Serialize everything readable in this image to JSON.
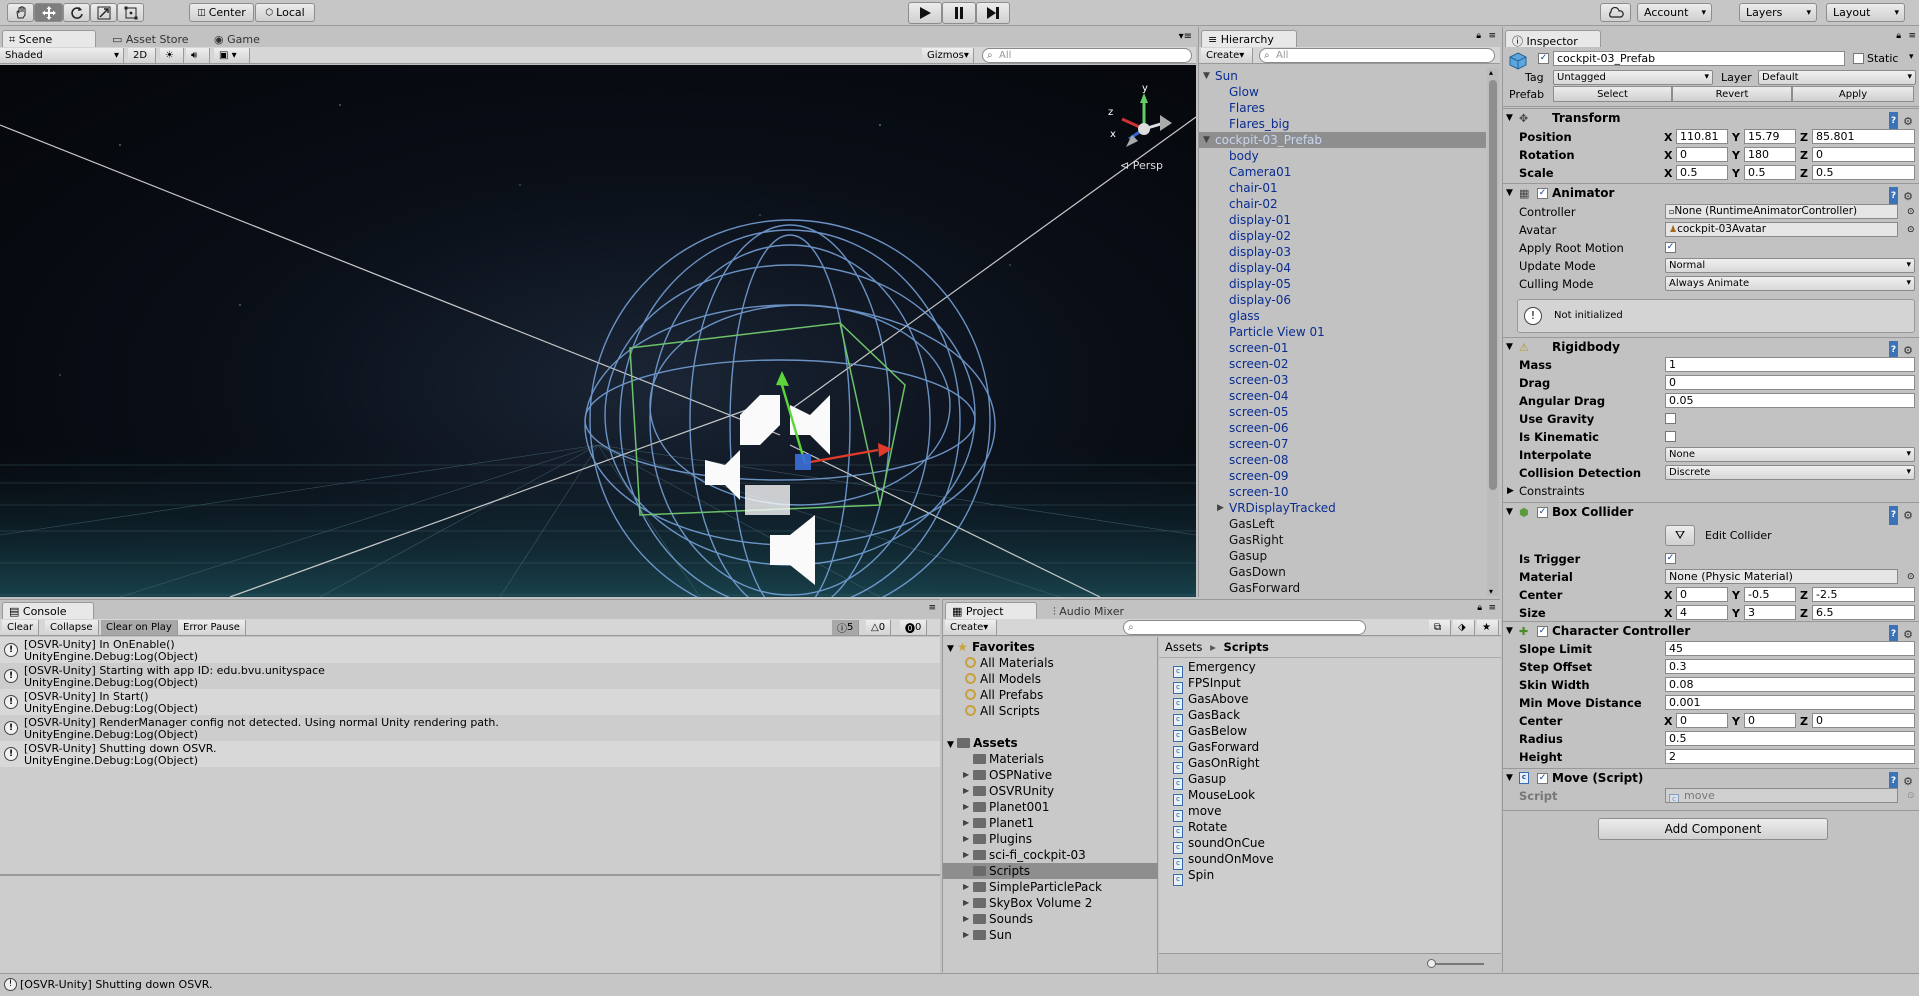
{
  "toolbar": {
    "center_label": "Center",
    "local_label": "Local",
    "account_label": "Account",
    "layers_label": "Layers",
    "layout_label": "Layout"
  },
  "scene": {
    "tabs": [
      "Scene",
      "Asset Store",
      "Game"
    ],
    "shading": "Shaded",
    "mode_2d": "2D",
    "gizmos_label": "Gizmos",
    "search_placeholder": "All",
    "persp_label": "Persp",
    "axis_y": "y",
    "axis_z": "z",
    "axis_x": "x"
  },
  "hierarchy": {
    "tab": "Hierarchy",
    "create_label": "Create",
    "search_placeholder": "All",
    "items": [
      {
        "label": "Sun",
        "depth": 0,
        "arrow": "▼",
        "color": "blue"
      },
      {
        "label": "Glow",
        "depth": 1,
        "arrow": "",
        "color": "blue"
      },
      {
        "label": "Flares",
        "depth": 1,
        "arrow": "",
        "color": "blue"
      },
      {
        "label": "Flares_big",
        "depth": 1,
        "arrow": "",
        "color": "blue"
      },
      {
        "label": "cockpit-03_Prefab",
        "depth": 0,
        "arrow": "▼",
        "color": "blue",
        "selected": true
      },
      {
        "label": "body",
        "depth": 1,
        "arrow": "",
        "color": "blue"
      },
      {
        "label": "Camera01",
        "depth": 1,
        "arrow": "",
        "color": "blue"
      },
      {
        "label": "chair-01",
        "depth": 1,
        "arrow": "",
        "color": "blue"
      },
      {
        "label": "chair-02",
        "depth": 1,
        "arrow": "",
        "color": "blue"
      },
      {
        "label": "display-01",
        "depth": 1,
        "arrow": "",
        "color": "blue"
      },
      {
        "label": "display-02",
        "depth": 1,
        "arrow": "",
        "color": "blue"
      },
      {
        "label": "display-03",
        "depth": 1,
        "arrow": "",
        "color": "blue"
      },
      {
        "label": "display-04",
        "depth": 1,
        "arrow": "",
        "color": "blue"
      },
      {
        "label": "display-05",
        "depth": 1,
        "arrow": "",
        "color": "blue"
      },
      {
        "label": "display-06",
        "depth": 1,
        "arrow": "",
        "color": "blue"
      },
      {
        "label": "glass",
        "depth": 1,
        "arrow": "",
        "color": "blue"
      },
      {
        "label": "Particle View 01",
        "depth": 1,
        "arrow": "",
        "color": "blue"
      },
      {
        "label": "screen-01",
        "depth": 1,
        "arrow": "",
        "color": "blue"
      },
      {
        "label": "screen-02",
        "depth": 1,
        "arrow": "",
        "color": "blue"
      },
      {
        "label": "screen-03",
        "depth": 1,
        "arrow": "",
        "color": "blue"
      },
      {
        "label": "screen-04",
        "depth": 1,
        "arrow": "",
        "color": "blue"
      },
      {
        "label": "screen-05",
        "depth": 1,
        "arrow": "",
        "color": "blue"
      },
      {
        "label": "screen-06",
        "depth": 1,
        "arrow": "",
        "color": "blue"
      },
      {
        "label": "screen-07",
        "depth": 1,
        "arrow": "",
        "color": "blue"
      },
      {
        "label": "screen-08",
        "depth": 1,
        "arrow": "",
        "color": "blue"
      },
      {
        "label": "screen-09",
        "depth": 1,
        "arrow": "",
        "color": "blue"
      },
      {
        "label": "screen-10",
        "depth": 1,
        "arrow": "",
        "color": "blue"
      },
      {
        "label": "VRDisplayTracked",
        "depth": 1,
        "arrow": "▶",
        "color": "blue"
      },
      {
        "label": "GasLeft",
        "depth": 1,
        "arrow": "",
        "color": "black"
      },
      {
        "label": "GasRight",
        "depth": 1,
        "arrow": "",
        "color": "black"
      },
      {
        "label": "Gasup",
        "depth": 1,
        "arrow": "",
        "color": "black"
      },
      {
        "label": "GasDown",
        "depth": 1,
        "arrow": "",
        "color": "black"
      },
      {
        "label": "GasForward",
        "depth": 1,
        "arrow": "",
        "color": "black"
      }
    ]
  },
  "inspector": {
    "tab": "Inspector",
    "object_name": "cockpit-03_Prefab",
    "static_label": "Static",
    "tag_label": "Tag",
    "tag_value": "Untagged",
    "layer_label": "Layer",
    "layer_value": "Default",
    "prefab_label": "Prefab",
    "select_label": "Select",
    "revert_label": "Revert",
    "apply_label": "Apply",
    "transform": {
      "title": "Transform",
      "position_label": "Position",
      "rotation_label": "Rotation",
      "scale_label": "Scale",
      "position": [
        "110.81",
        "15.79",
        "85.801"
      ],
      "rotation": [
        "0",
        "180",
        "0"
      ],
      "scale": [
        "0.5",
        "0.5",
        "0.5"
      ]
    },
    "animator": {
      "title": "Animator",
      "controller_label": "Controller",
      "controller_value": "None (RuntimeAnimatorController)",
      "avatar_label": "Avatar",
      "avatar_value": "cockpit-03Avatar",
      "root_motion_label": "Apply Root Motion",
      "update_mode_label": "Update Mode",
      "update_mode_value": "Normal",
      "culling_label": "Culling Mode",
      "culling_value": "Always Animate",
      "info": "Not initialized"
    },
    "rigidbody": {
      "title": "Rigidbody",
      "mass_label": "Mass",
      "mass": "1",
      "drag_label": "Drag",
      "drag": "0",
      "angular_label": "Angular Drag",
      "angular": "0.05",
      "gravity_label": "Use Gravity",
      "kinematic_label": "Is Kinematic",
      "interpolate_label": "Interpolate",
      "interpolate_value": "None",
      "collision_label": "Collision Detection",
      "collision_value": "Discrete",
      "constraints_label": "Constraints"
    },
    "box_collider": {
      "title": "Box Collider",
      "edit_label": "Edit Collider",
      "trigger_label": "Is Trigger",
      "material_label": "Material",
      "material_value": "None (Physic Material)",
      "center_label": "Center",
      "center": [
        "0",
        "-0.5",
        "-2.5"
      ],
      "size_label": "Size",
      "size": [
        "4",
        "3",
        "6.5"
      ]
    },
    "char_controller": {
      "title": "Character Controller",
      "slope_label": "Slope Limit",
      "slope": "45",
      "step_label": "Step Offset",
      "step": "0.3",
      "skin_label": "Skin Width",
      "skin": "0.08",
      "minmove_label": "Min Move Distance",
      "minmove": "0.001",
      "center_label": "Center",
      "center": [
        "0",
        "0",
        "0"
      ],
      "radius_label": "Radius",
      "radius": "0.5",
      "height_label": "Height",
      "height": "2"
    },
    "move_script": {
      "title": "Move (Script)",
      "script_label": "Script",
      "script_value": "move"
    },
    "add_component": "Add Component",
    "axes": [
      "X",
      "Y",
      "Z"
    ]
  },
  "console": {
    "tab": "Console",
    "clear": "Clear",
    "collapse": "Collapse",
    "clear_on_play": "Clear on Play",
    "error_pause": "Error Pause",
    "count_info": "5",
    "count_warn": "0",
    "count_err": "0",
    "entries": [
      {
        "line1": "[OSVR-Unity] In OnEnable()",
        "line2": "UnityEngine.Debug:Log(Object)"
      },
      {
        "line1": "[OSVR-Unity] Starting with app ID: edu.bvu.unityspace",
        "line2": "UnityEngine.Debug:Log(Object)"
      },
      {
        "line1": "[OSVR-Unity] In Start()",
        "line2": "UnityEngine.Debug:Log(Object)"
      },
      {
        "line1": "[OSVR-Unity] RenderManager config not detected. Using normal Unity rendering path.",
        "line2": "UnityEngine.Debug:Log(Object)"
      },
      {
        "line1": "[OSVR-Unity] Shutting down OSVR.",
        "line2": "UnityEngine.Debug:Log(Object)"
      }
    ]
  },
  "project": {
    "tab": "Project",
    "tab2": "Audio Mixer",
    "create_label": "Create",
    "favorites_label": "Favorites",
    "favorites": [
      "All Materials",
      "All Models",
      "All Prefabs",
      "All Scripts"
    ],
    "assets_label": "Assets",
    "folders": [
      {
        "label": "Materials",
        "arrow": ""
      },
      {
        "label": "OSPNative",
        "arrow": "▶"
      },
      {
        "label": "OSVRUnity",
        "arrow": "▶"
      },
      {
        "label": "Planet001",
        "arrow": "▶"
      },
      {
        "label": "Planet1",
        "arrow": "▶"
      },
      {
        "label": "Plugins",
        "arrow": "▶"
      },
      {
        "label": "sci-fi_cockpit-03",
        "arrow": "▶"
      },
      {
        "label": "Scripts",
        "arrow": "",
        "selected": true
      },
      {
        "label": "SimpleParticlePack",
        "arrow": "▶"
      },
      {
        "label": "SkyBox Volume 2",
        "arrow": "▶"
      },
      {
        "label": "Sounds",
        "arrow": "▶"
      },
      {
        "label": "Sun",
        "arrow": "▶"
      }
    ],
    "breadcrumb_root": "Assets",
    "breadcrumb_sep": "▸",
    "breadcrumb_current": "Scripts",
    "scripts": [
      "Emergency",
      "FPSInput",
      "GasAbove",
      "GasBack",
      "GasBelow",
      "GasForward",
      "GasOnRight",
      "Gasup",
      "MouseLook",
      "move",
      "Rotate",
      "soundOnCue",
      "soundOnMove",
      "Spin"
    ]
  },
  "status_bar": {
    "message": "[OSVR-Unity] Shutting down OSVR."
  }
}
